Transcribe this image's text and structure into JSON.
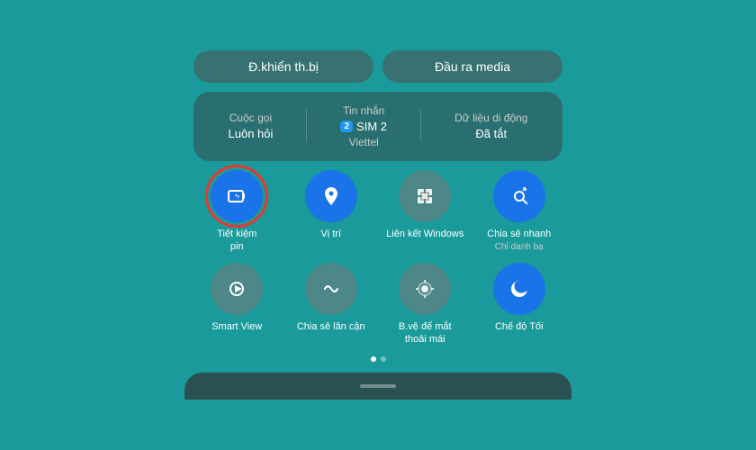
{
  "topButtons": {
    "btn1": "Đ.khiển th.bị",
    "btn2": "Đầu ra media"
  },
  "simRow": {
    "item1": {
      "label": "Cuộc gọi",
      "value": "Luôn hỏi"
    },
    "item2": {
      "label": "Tin nhắn",
      "badge": "2",
      "sim": "SIM 2",
      "carrier": "Viettel"
    },
    "item3": {
      "label": "Dữ liệu di động",
      "value": "Đã tắt"
    }
  },
  "row1Tiles": [
    {
      "id": "battery-saver",
      "label": "Tiết kiệm\npin",
      "sublabel": "",
      "iconColor": "active"
    },
    {
      "id": "location",
      "label": "Vị trí",
      "sublabel": "",
      "iconColor": "blue"
    },
    {
      "id": "link-windows",
      "label": "Liên kết Windows",
      "sublabel": "",
      "iconColor": "gray"
    },
    {
      "id": "quick-share",
      "label": "Chia sẻ nhanh",
      "sublabel": "Chỉ danh bạ",
      "iconColor": "blue"
    }
  ],
  "row2Tiles": [
    {
      "id": "smart-view",
      "label": "Smart View",
      "sublabel": "",
      "iconColor": "gray"
    },
    {
      "id": "nearby-share",
      "label": "Chia sẻ lân cận",
      "sublabel": "",
      "iconColor": "gray"
    },
    {
      "id": "eye-comfort",
      "label": "B.vệ để mắt\nthoải mái",
      "sublabel": "",
      "iconColor": "gray"
    },
    {
      "id": "dark-mode",
      "label": "Chế độ Tối",
      "sublabel": "",
      "iconColor": "blue"
    }
  ],
  "dots": [
    true,
    false
  ],
  "icons": {
    "battery": "🔋",
    "location": "📍",
    "windows": "🖥",
    "share": "🔄",
    "smartview": "▶",
    "nearbyshare": "〰",
    "eyecomfort": "🔆",
    "darkmode": "🌙"
  }
}
